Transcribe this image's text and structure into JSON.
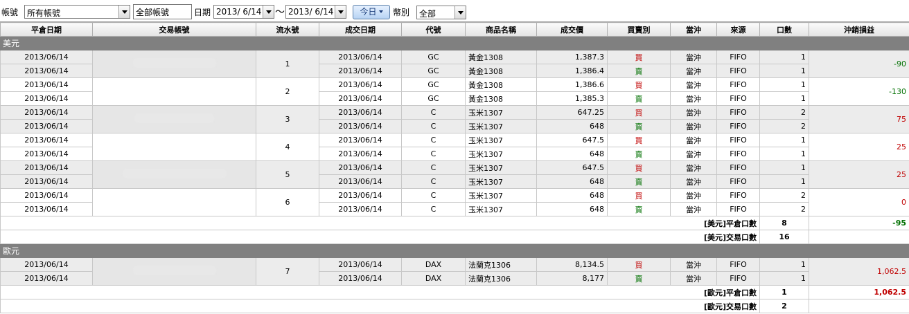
{
  "toolbar": {
    "account_label": "帳號",
    "account_value": "所有帳號",
    "account_type_value": "全部帳號",
    "date_label": "日期",
    "date_from": "2013/  6/14",
    "date_to": "2013/  6/14",
    "date_separator": "～",
    "today_button": "今日",
    "currency_label": "幣別",
    "currency_value": "全部"
  },
  "columns": [
    "平倉日期",
    "交易帳號",
    "流水號",
    "成交日期",
    "代號",
    "商品名稱",
    "成交價",
    "買賣別",
    "當沖",
    "來源",
    "口數",
    "沖銷損益"
  ],
  "groups": [
    {
      "name": "美元",
      "trades": [
        {
          "serial": "1",
          "pnl": "-90",
          "pnl_sign": "neg",
          "rows": [
            {
              "close_date": "2013/06/14",
              "trade_date": "2013/06/14",
              "code": "GC",
              "product": "黃金1308",
              "price": "1,387.3",
              "side": "買",
              "daytrade": "當沖",
              "source": "FIFO",
              "qty": "1"
            },
            {
              "close_date": "2013/06/14",
              "trade_date": "2013/06/14",
              "code": "GC",
              "product": "黃金1308",
              "price": "1,386.4",
              "side": "賣",
              "daytrade": "當沖",
              "source": "FIFO",
              "qty": "1"
            }
          ]
        },
        {
          "serial": "2",
          "pnl": "-130",
          "pnl_sign": "neg",
          "rows": [
            {
              "close_date": "2013/06/14",
              "trade_date": "2013/06/14",
              "code": "GC",
              "product": "黃金1308",
              "price": "1,386.6",
              "side": "買",
              "daytrade": "當沖",
              "source": "FIFO",
              "qty": "1"
            },
            {
              "close_date": "2013/06/14",
              "trade_date": "2013/06/14",
              "code": "GC",
              "product": "黃金1308",
              "price": "1,385.3",
              "side": "賣",
              "daytrade": "當沖",
              "source": "FIFO",
              "qty": "1"
            }
          ]
        },
        {
          "serial": "3",
          "pnl": "75",
          "pnl_sign": "pos",
          "rows": [
            {
              "close_date": "2013/06/14",
              "trade_date": "2013/06/14",
              "code": "C",
              "product": "玉米1307",
              "price": "647.25",
              "side": "買",
              "daytrade": "當沖",
              "source": "FIFO",
              "qty": "2"
            },
            {
              "close_date": "2013/06/14",
              "trade_date": "2013/06/14",
              "code": "C",
              "product": "玉米1307",
              "price": "648",
              "side": "賣",
              "daytrade": "當沖",
              "source": "FIFO",
              "qty": "2"
            }
          ]
        },
        {
          "serial": "4",
          "pnl": "25",
          "pnl_sign": "pos",
          "rows": [
            {
              "close_date": "2013/06/14",
              "trade_date": "2013/06/14",
              "code": "C",
              "product": "玉米1307",
              "price": "647.5",
              "side": "買",
              "daytrade": "當沖",
              "source": "FIFO",
              "qty": "1"
            },
            {
              "close_date": "2013/06/14",
              "trade_date": "2013/06/14",
              "code": "C",
              "product": "玉米1307",
              "price": "648",
              "side": "賣",
              "daytrade": "當沖",
              "source": "FIFO",
              "qty": "1"
            }
          ]
        },
        {
          "serial": "5",
          "pnl": "25",
          "pnl_sign": "pos",
          "rows": [
            {
              "close_date": "2013/06/14",
              "trade_date": "2013/06/14",
              "code": "C",
              "product": "玉米1307",
              "price": "647.5",
              "side": "買",
              "daytrade": "當沖",
              "source": "FIFO",
              "qty": "1"
            },
            {
              "close_date": "2013/06/14",
              "trade_date": "2013/06/14",
              "code": "C",
              "product": "玉米1307",
              "price": "648",
              "side": "賣",
              "daytrade": "當沖",
              "source": "FIFO",
              "qty": "1"
            }
          ]
        },
        {
          "serial": "6",
          "pnl": "0",
          "pnl_sign": "pos",
          "rows": [
            {
              "close_date": "2013/06/14",
              "trade_date": "2013/06/14",
              "code": "C",
              "product": "玉米1307",
              "price": "648",
              "side": "買",
              "daytrade": "當沖",
              "source": "FIFO",
              "qty": "2"
            },
            {
              "close_date": "2013/06/14",
              "trade_date": "2013/06/14",
              "code": "C",
              "product": "玉米1307",
              "price": "648",
              "side": "賣",
              "daytrade": "當沖",
              "source": "FIFO",
              "qty": "2"
            }
          ]
        }
      ],
      "close_qty_label": "[美元]平倉口數",
      "close_qty": "8",
      "close_pnl": "-95",
      "close_pnl_sign": "neg",
      "trade_qty_label": "[美元]交易口數",
      "trade_qty": "16"
    },
    {
      "name": "歐元",
      "trades": [
        {
          "serial": "7",
          "pnl": "1,062.5",
          "pnl_sign": "pos",
          "rows": [
            {
              "close_date": "2013/06/14",
              "trade_date": "2013/06/14",
              "code": "DAX",
              "product": "法蘭克1306",
              "price": "8,134.5",
              "side": "買",
              "daytrade": "當沖",
              "source": "FIFO",
              "qty": "1"
            },
            {
              "close_date": "2013/06/14",
              "trade_date": "2013/06/14",
              "code": "DAX",
              "product": "法蘭克1306",
              "price": "8,177",
              "side": "賣",
              "daytrade": "當沖",
              "source": "FIFO",
              "qty": "1"
            }
          ]
        }
      ],
      "close_qty_label": "[歐元]平倉口數",
      "close_qty": "1",
      "close_pnl": "1,062.5",
      "close_pnl_sign": "pos",
      "trade_qty_label": "[歐元]交易口數",
      "trade_qty": "2"
    }
  ],
  "colors": {
    "buy": "#c00000",
    "sell": "#007000",
    "group_header": "#808080",
    "row_alt": "#ececec"
  }
}
